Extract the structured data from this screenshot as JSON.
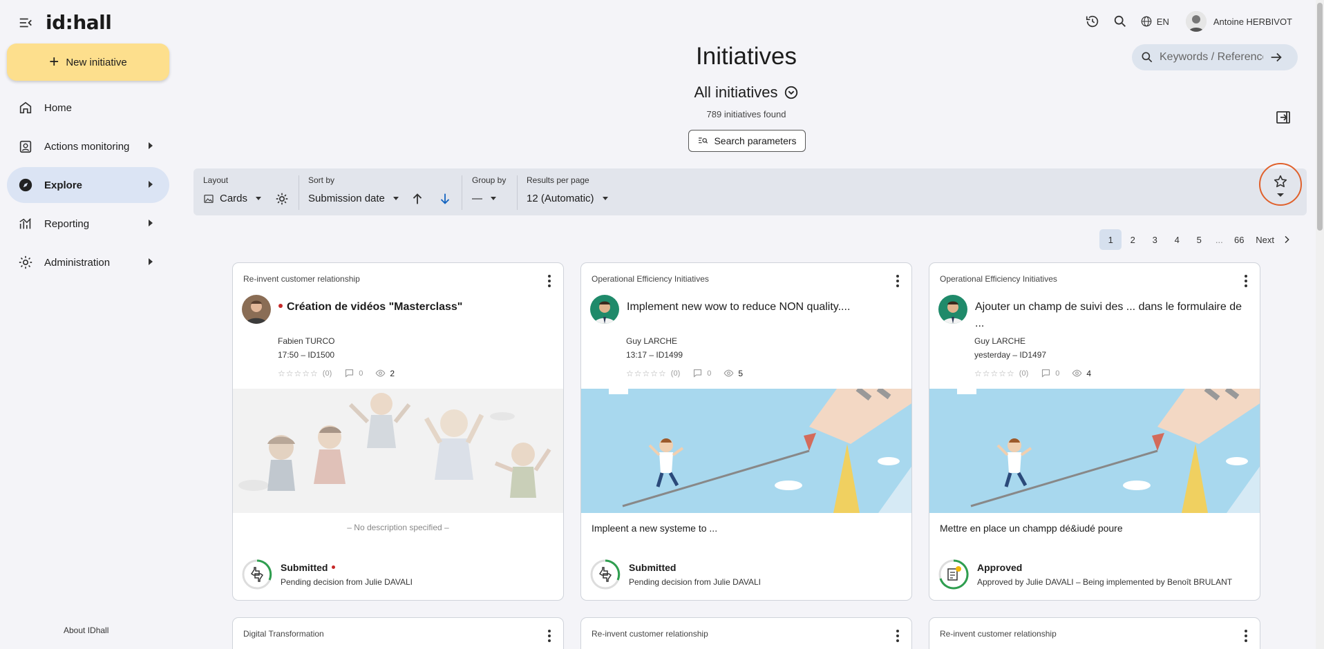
{
  "app": {
    "logo": "id:hall",
    "language": "EN",
    "user_name": "Antoine HERBIVOT"
  },
  "sidebar": {
    "new_button": "New initiative",
    "items": [
      {
        "label": "Home"
      },
      {
        "label": "Actions monitoring"
      },
      {
        "label": "Explore"
      },
      {
        "label": "Reporting"
      },
      {
        "label": "Administration"
      }
    ],
    "about": "About IDhall"
  },
  "search": {
    "placeholder": "Keywords / Reference"
  },
  "header": {
    "title": "Initiatives",
    "subtitle": "All initiatives",
    "count_num": "789",
    "count_text": "initiatives found",
    "search_params": "Search parameters"
  },
  "toolbar": {
    "layout_label": "Layout",
    "layout_value": "Cards",
    "sort_label": "Sort by",
    "sort_value": "Submission date",
    "group_label": "Group by",
    "group_value": "—",
    "results_label": "Results per page",
    "results_value": "12 (Automatic)"
  },
  "pagination": {
    "pages": [
      "1",
      "2",
      "3",
      "4",
      "5",
      "...",
      "66"
    ],
    "next": "Next",
    "current": "1"
  },
  "cards": [
    {
      "category": "Re-invent customer relationship",
      "title": "Création de vidéos \"Masterclass\"",
      "author": "Fabien TURCO",
      "meta": "17:50 – ID1500",
      "rating": "(0)",
      "comments": "0",
      "views": "2",
      "description": "– No description specified –",
      "status": "Submitted",
      "status_sub": "Pending decision from Julie DAVALI"
    },
    {
      "category": "Operational Efficiency Initiatives",
      "title": "Implement new wow to reduce NON quality....",
      "author": "Guy LARCHE",
      "meta": "13:17 – ID1499",
      "rating": "(0)",
      "comments": "0",
      "views": "5",
      "description": "Impleent a new systeme to ...",
      "status": "Submitted",
      "status_sub": "Pending decision from Julie DAVALI"
    },
    {
      "category": "Operational Efficiency Initiatives",
      "title": "Ajouter un champ de suivi des ... dans le formulaire de ...",
      "author": "Guy LARCHE",
      "meta": "yesterday – ID1497",
      "rating": "(0)",
      "comments": "0",
      "views": "4",
      "description": "Mettre en place un champp dé&iudé poure",
      "status": "Approved",
      "status_sub": "Approved by Julie DAVALI – Being implemented by Benoît BRULANT"
    }
  ],
  "next_cards": [
    {
      "category": "Digital Transformation"
    },
    {
      "category": "Re-invent customer relationship"
    },
    {
      "category": "Re-invent customer relationship"
    }
  ],
  "colors": {
    "accent_button": "#fddf8d",
    "active_nav": "#dbe4f4",
    "highlight_ring": "#e0602b",
    "status_green": "#2e9e4f",
    "red_dot": "#c62828"
  }
}
